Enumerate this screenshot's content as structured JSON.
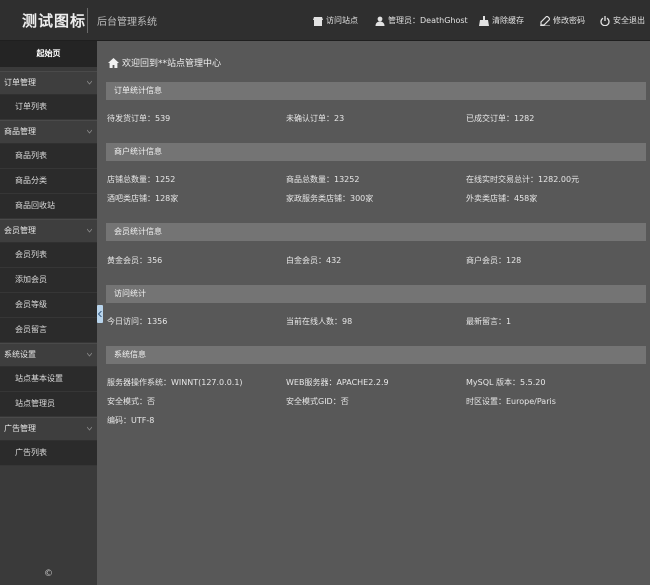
{
  "header": {
    "logo": "测试图标",
    "subtitle": "后台管理系统",
    "nav": {
      "visit": "访问站点",
      "admin": "管理员：DeathGhost",
      "clear": "清除缓存",
      "password": "修改密码",
      "logout": "安全退出"
    }
  },
  "sidebar": {
    "home": "起始页",
    "groups": [
      {
        "label": "订单管理",
        "items": [
          "订单列表"
        ]
      },
      {
        "label": "商品管理",
        "items": [
          "商品列表",
          "商品分类",
          "商品回收站"
        ]
      },
      {
        "label": "会员管理",
        "items": [
          "会员列表",
          "添加会员",
          "会员等级",
          "会员留言"
        ]
      },
      {
        "label": "系统设置",
        "items": [
          "站点基本设置",
          "站点管理员"
        ]
      },
      {
        "label": "广告管理",
        "items": [
          "广告列表"
        ]
      }
    ],
    "copyright": "©"
  },
  "main": {
    "welcome": "欢迎回到**站点管理中心",
    "sections": [
      {
        "title": "订单统计信息",
        "rows": [
          [
            "待发货订单：539",
            "未确认订单：23",
            "已成交订单：1282"
          ]
        ]
      },
      {
        "title": "商户统计信息",
        "rows": [
          [
            "店铺总数量：1252",
            "商品总数量：13252",
            "在线实时交易总计：1282.00元"
          ],
          [
            "酒吧类店铺：128家",
            "家政服务类店铺：300家",
            "外卖类店铺：458家"
          ]
        ]
      },
      {
        "title": "会员统计信息",
        "rows": [
          [
            "黄金会员：356",
            "白金会员：432",
            "商户会员：128"
          ]
        ]
      },
      {
        "title": "访问统计",
        "rows": [
          [
            "今日访问：1356",
            "当前在线人数：98",
            "最新留言：1"
          ]
        ]
      },
      {
        "title": "系统信息",
        "rows": [
          [
            "服务器操作系统：WINNT(127.0.0.1)",
            "WEB服务器：APACHE2.2.9",
            "MySQL 版本：5.5.20"
          ],
          [
            "安全模式：否",
            "安全模式GID：否",
            "时区设置：Europe/Paris"
          ],
          [
            "编码：UTF-8"
          ]
        ]
      }
    ]
  }
}
